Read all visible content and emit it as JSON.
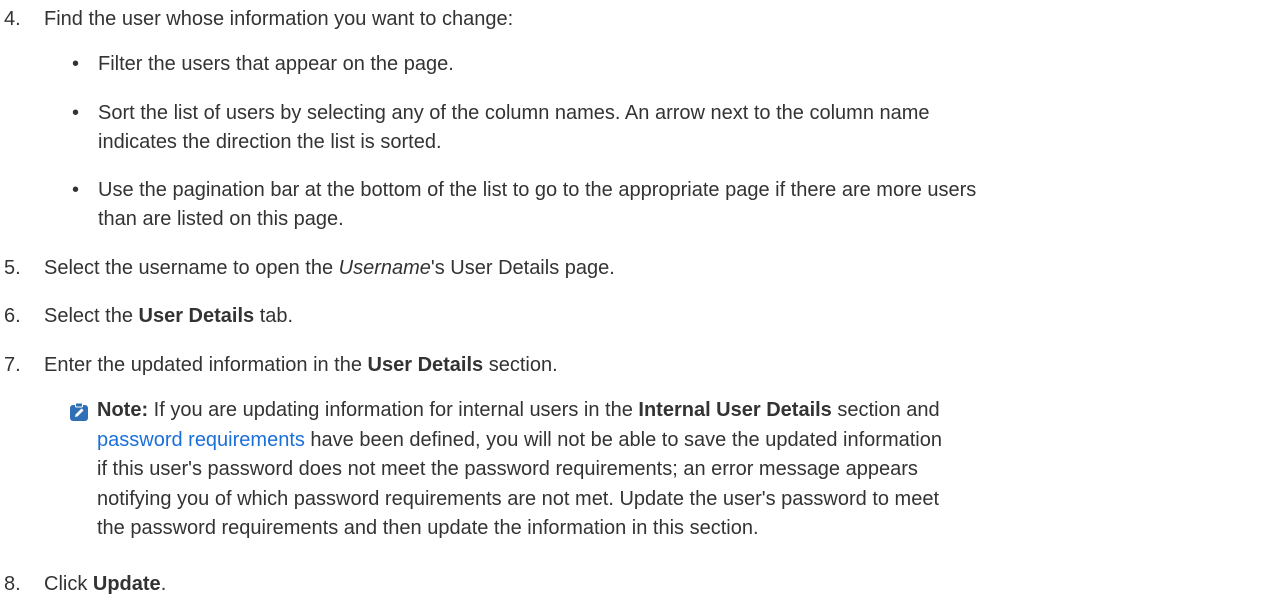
{
  "step4": {
    "num": "4.",
    "text": "Find the user whose information you want to change:"
  },
  "bullets": [
    {
      "text": "Filter the users that appear on the page."
    },
    {
      "line1": "Sort the list of users by selecting any of the column names. An arrow next to the column name",
      "line2": "indicates the direction the list is sorted."
    },
    {
      "line1": "Use the pagination bar at the bottom of the list to go to the appropriate page if there are more users",
      "line2": "than are listed on this page."
    }
  ],
  "step5": {
    "num": "5.",
    "pre": "Select the username to open the ",
    "italic": "Username",
    "post": "'s User Details page."
  },
  "step6": {
    "num": "6.",
    "pre": "Select the ",
    "bold": "User Details",
    "post": " tab."
  },
  "step7": {
    "num": "7.",
    "pre": "Enter the updated information in the ",
    "bold": "User Details",
    "post": " section."
  },
  "note": {
    "icon": "edit-note-icon",
    "label": "Note:",
    "line1_pre": " If you are updating information for internal users in the ",
    "line1_bold": "Internal User Details",
    "line1_post": " section and",
    "link_text": "password requirements",
    "line2_post": " have been defined, you will not be able to save the updated information",
    "line3": "if this user's password does not meet the password requirements; an error message appears",
    "line4": "notifying you of which password requirements are not met. Update the user's password to meet",
    "line5": "the password requirements and then update the information in this section."
  },
  "step8": {
    "num": "8.",
    "pre": "Click ",
    "bold": "Update",
    "post": "."
  },
  "colors": {
    "text": "#333333",
    "link": "#1a6fd9",
    "note_icon_bg": "#2f6fb6"
  }
}
